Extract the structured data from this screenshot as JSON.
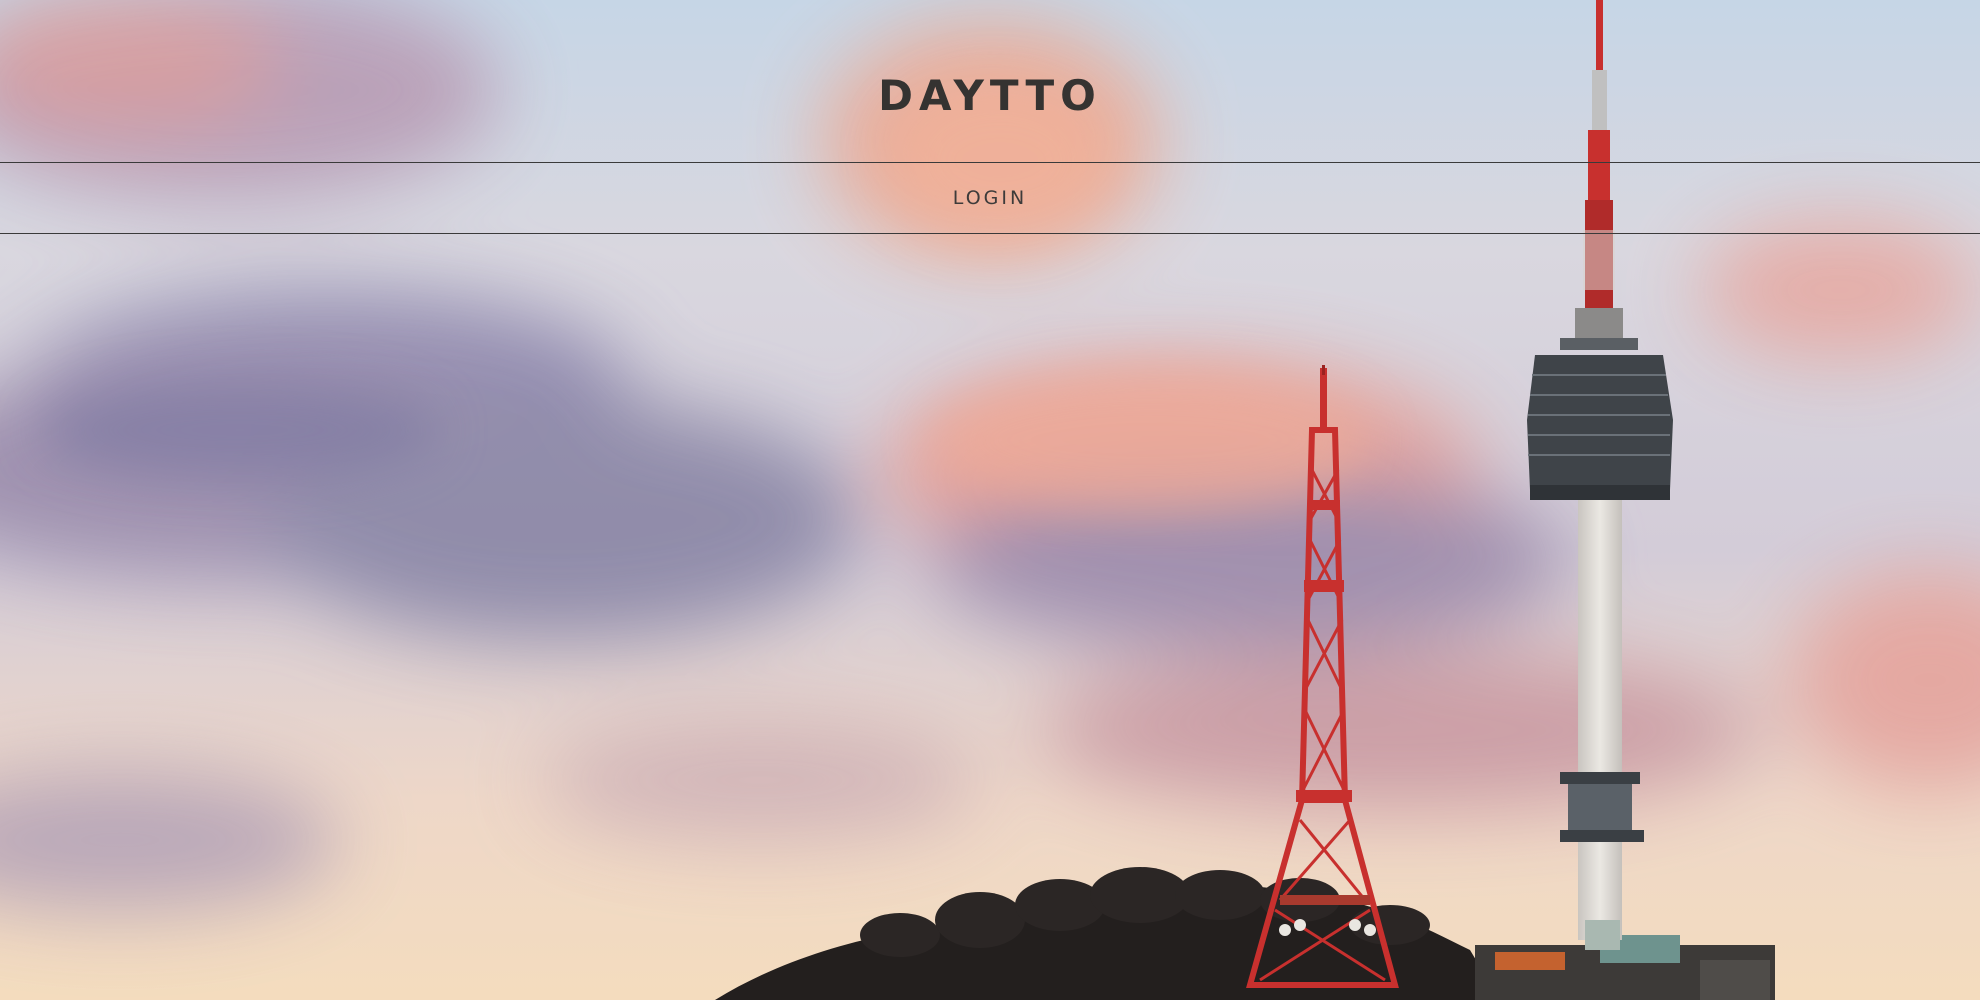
{
  "header": {
    "site_title": "DAYTTO"
  },
  "nav": {
    "items": [
      {
        "label": "LOGIN"
      }
    ]
  },
  "background": {
    "subject": "city-tower-sunset-photo",
    "colors": {
      "sky_top": "#c9d9e8",
      "sky_mid": "#d6cfd8",
      "sky_bottom": "#f2d9c0",
      "cloud_pink": "#e9a89c",
      "cloud_purple": "#8c85a8",
      "tower_red": "#c8302e",
      "tower_shaft": "#e2e0dc",
      "tower_pod": "#3f4449",
      "hill": "#22201f"
    }
  }
}
